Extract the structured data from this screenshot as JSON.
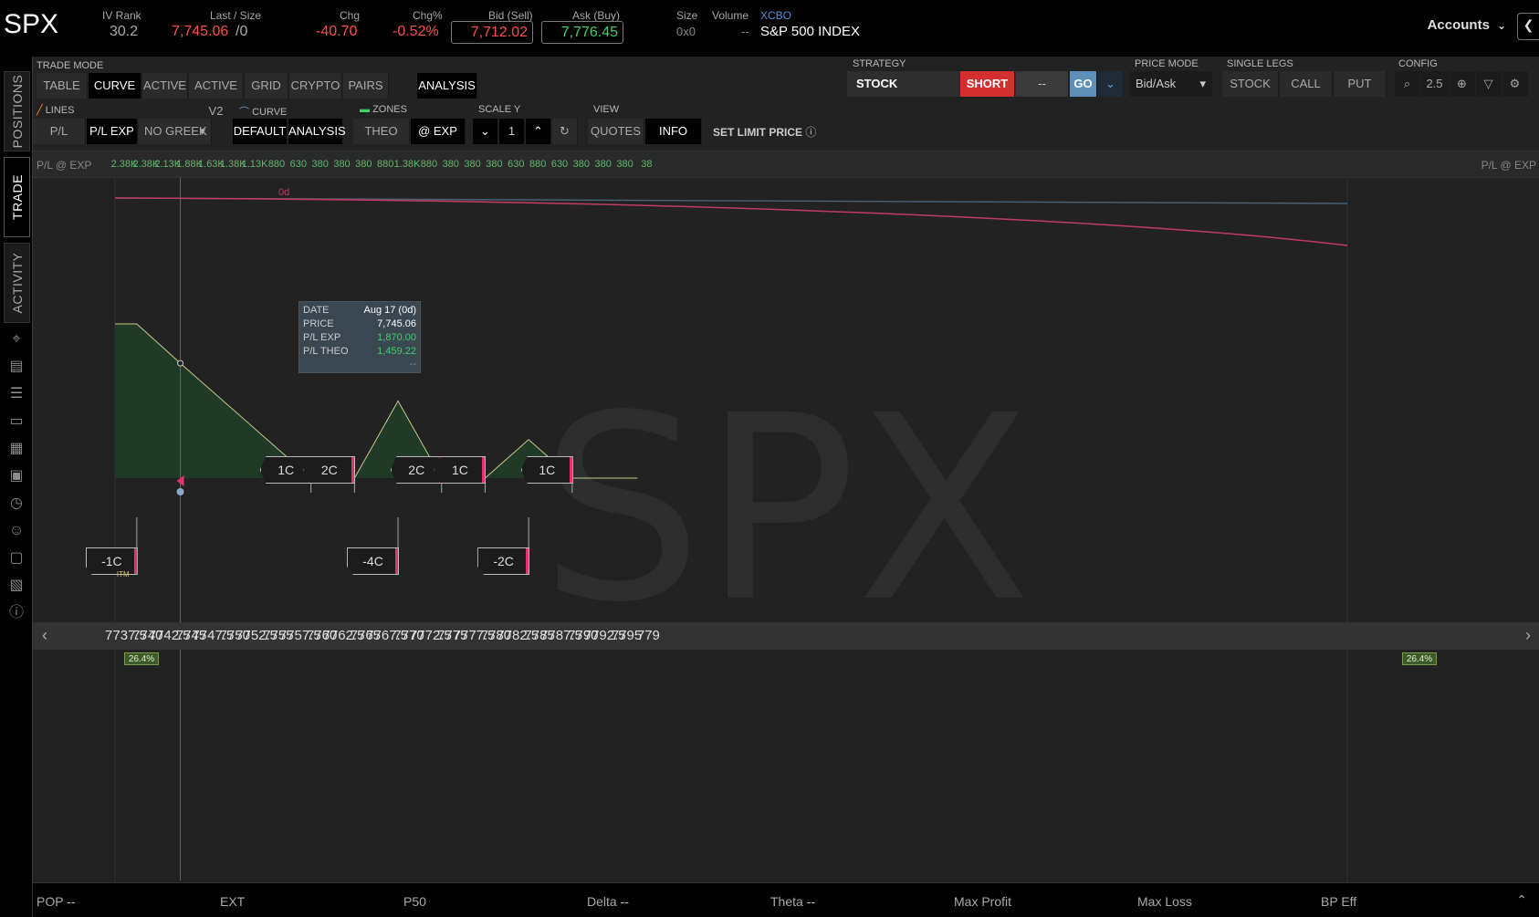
{
  "header": {
    "symbol": "SPX",
    "iv_rank_label": "IV Rank",
    "iv_rank": "30.2",
    "last_label": "Last / Size",
    "last": "7,745.06",
    "last_size": "/0",
    "chg_label": "Chg",
    "chg": "-40.70",
    "chgpct_label": "Chg%",
    "chgpct": "-0.52%",
    "bid_label": "Bid (Sell)",
    "bid": "7,712.02",
    "ask_label": "Ask (Buy)",
    "ask": "7,776.45",
    "size_label": "Size",
    "size": "0x0",
    "volume_label": "Volume",
    "volume": "--",
    "exchange": "XCBO",
    "description": "S&P 500 INDEX",
    "accounts": "Accounts",
    "colors": {
      "down": "#ff4d4d",
      "up": "#3ecf6a"
    }
  },
  "rail": {
    "positions": "POSITIONS",
    "trade": "TRADE",
    "activity": "ACTIVITY"
  },
  "toolbar": {
    "trade_mode_label": "TRADE MODE",
    "modes": [
      "TABLE",
      "CURVE",
      "ACTIVE",
      "ACTIVE V2",
      "GRID",
      "CRYPTO",
      "PAIRS",
      "ANALYSIS"
    ],
    "strategy_label": "STRATEGY",
    "strategy": "STOCK",
    "short": "SHORT",
    "qty": "--",
    "go": "GO",
    "price_mode_label": "PRICE MODE",
    "price_mode": "Bid/Ask",
    "single_legs_label": "SINGLE LEGS",
    "legs": [
      "STOCK",
      "CALL",
      "PUT"
    ],
    "config_label": "CONFIG",
    "zoom": "2.5",
    "lines_label": "LINES",
    "lines": [
      "P/L THEO",
      "P/L EXP",
      "NO GREEK"
    ],
    "curve_label": "CURVE",
    "curve": [
      "DEFAULT",
      "ANALYSIS"
    ],
    "zones_label": "ZONES",
    "zones": [
      "THEO",
      "@ EXP"
    ],
    "scale_label": "SCALE Y",
    "scale": "1",
    "view_label": "VIEW",
    "view": [
      "QUOTES",
      "INFO"
    ],
    "set_limit": "SET LIMIT PRICE"
  },
  "plrow": {
    "label": "P/L @ EXP",
    "ticks": [
      "2.38K",
      "2.38K",
      "2.13K",
      "1.88K",
      "1.63K",
      "1.38K",
      "1.13K",
      "880",
      "630",
      "380",
      "380",
      "380",
      "880",
      "1.38K",
      "880",
      "380",
      "380",
      "380",
      "630",
      "880",
      "630",
      "380",
      "380",
      "380",
      "38"
    ]
  },
  "chart_data": {
    "type": "area",
    "x": [
      7737.5,
      7740,
      7745,
      7760,
      7765,
      7770,
      7775,
      7780,
      7785,
      7790,
      7797.5
    ],
    "series": [
      {
        "values": [
          2380,
          2380,
          1870,
          380,
          380,
          1380,
          380,
          380,
          880,
          380,
          380
        ]
      }
    ],
    "xticks": [
      "7737.5",
      "7740",
      "7742.5",
      "7745",
      "7747.5",
      "7750",
      "7752.5",
      "7755",
      "7757.5",
      "7760",
      "7762.5",
      "7765",
      "7767.5",
      "7770",
      "7772.5",
      "7775",
      "7777.5",
      "7780",
      "7782.5",
      "7785",
      "7787.5",
      "7790",
      "7792.5",
      "7795",
      "779"
    ],
    "xlim": [
      7736,
      7797.5
    ],
    "watermark": "SPX",
    "day_label": "0d",
    "pct_left": "26.4%",
    "pct_right": "26.4%",
    "legs_top": [
      {
        "label": "1C",
        "x": 7760
      },
      {
        "label": "2C",
        "x": 7765
      },
      {
        "label": "2C",
        "x": 7775
      },
      {
        "label": "1C",
        "x": 7780
      },
      {
        "label": "1C",
        "x": 7790
      }
    ],
    "legs_bottom": [
      {
        "label": "-1C",
        "x": 7740
      },
      {
        "label": "-4C",
        "x": 7770
      },
      {
        "label": "-2C",
        "x": 7785
      }
    ],
    "itm": "ITM",
    "colors": {
      "area": "#1f3a27",
      "line": "#c9c98a",
      "theo": "#c23b63",
      "ref": "#4a6073"
    }
  },
  "info": {
    "date_label": "DATE",
    "date": "Aug 17 (0d)",
    "price_label": "PRICE",
    "price": "7,745.06",
    "plexp_label": "P/L EXP",
    "plexp": "1,870.00",
    "pltheo_label": "P/L THEO",
    "pltheo": "1,459.22",
    "extra": "--"
  },
  "status": {
    "pop": "POP",
    "pop_val": "--",
    "ext": "EXT",
    "p50": "P50",
    "delta": "Delta",
    "delta_val": "--",
    "theta": "Theta",
    "theta_val": "--",
    "max_profit": "Max Profit",
    "max_loss": "Max Loss",
    "bp_eff": "BP Eff"
  }
}
